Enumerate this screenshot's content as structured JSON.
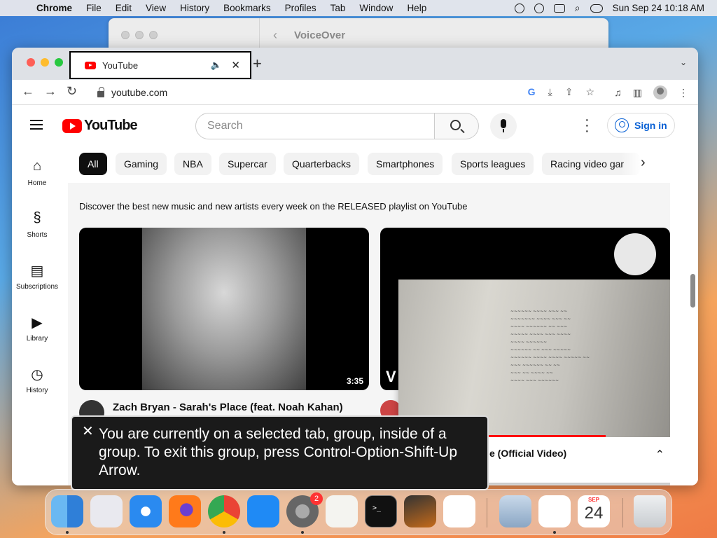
{
  "menubar": {
    "items": [
      "Chrome",
      "File",
      "Edit",
      "View",
      "History",
      "Bookmarks",
      "Profiles",
      "Tab",
      "Window",
      "Help"
    ],
    "clock": "Sun Sep 24 10:18 AM"
  },
  "voiceover_window": {
    "title": "VoiceOver"
  },
  "browser": {
    "tab_title": "YouTube",
    "url": "youtube.com"
  },
  "youtube": {
    "logo_text": "YouTube",
    "search_placeholder": "Search",
    "signin_label": "Sign in",
    "sidebar": [
      {
        "label": "Home",
        "icon": "home-icon"
      },
      {
        "label": "Shorts",
        "icon": "shorts-icon"
      },
      {
        "label": "Subscriptions",
        "icon": "subscriptions-icon"
      },
      {
        "label": "Library",
        "icon": "library-icon"
      },
      {
        "label": "History",
        "icon": "history-icon"
      }
    ],
    "chips": [
      "All",
      "Gaming",
      "NBA",
      "Supercar",
      "Quarterbacks",
      "Smartphones",
      "Sports leagues",
      "Racing video gar"
    ],
    "description": "Discover the best new music and new artists every week on the RELEASED playlist on YouTube",
    "videos": [
      {
        "title": "Zach Bryan - Sarah's Place (feat. Noah Kahan)",
        "duration": "3:35"
      },
      {
        "title": "V"
      }
    ],
    "miniplayer": {
      "title_fragment": "e (Official Video)",
      "progress": 0.74
    }
  },
  "voiceover_caption": "You are currently on a selected tab, group, inside of a group.  To exit this group, press Control-Option-Shift-Up Arrow.",
  "dock": {
    "apps": [
      "Finder",
      "Launchpad",
      "Safari",
      "Firefox",
      "Chrome",
      "App Store",
      "System Settings",
      "TextEdit",
      "Terminal",
      "GarageBand",
      "Visual Studio Code",
      "Preview",
      "Freeform",
      "Calendar",
      "Trash"
    ],
    "settings_badge": "2",
    "calendar_month": "SEP",
    "calendar_day": "24",
    "terminal_prompt": ">_"
  }
}
